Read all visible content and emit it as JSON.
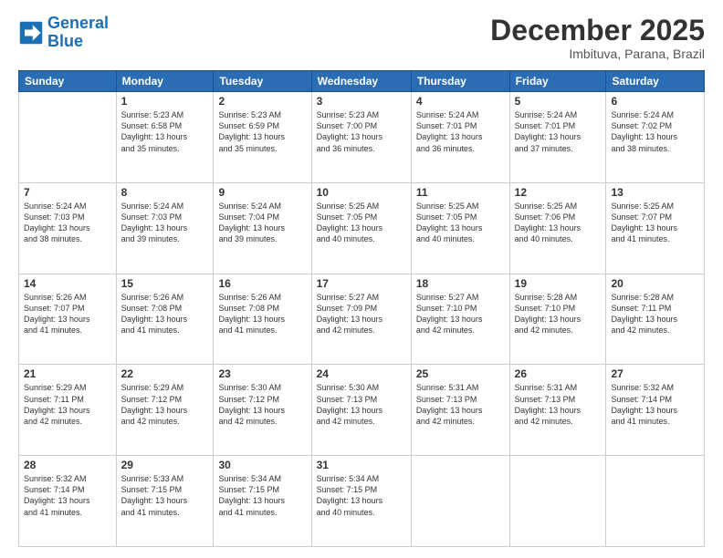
{
  "header": {
    "logo_line1": "General",
    "logo_line2": "Blue",
    "month": "December 2025",
    "location": "Imbituva, Parana, Brazil"
  },
  "days_of_week": [
    "Sunday",
    "Monday",
    "Tuesday",
    "Wednesday",
    "Thursday",
    "Friday",
    "Saturday"
  ],
  "weeks": [
    [
      {
        "day": "",
        "content": ""
      },
      {
        "day": "1",
        "content": "Sunrise: 5:23 AM\nSunset: 6:58 PM\nDaylight: 13 hours\nand 35 minutes."
      },
      {
        "day": "2",
        "content": "Sunrise: 5:23 AM\nSunset: 6:59 PM\nDaylight: 13 hours\nand 35 minutes."
      },
      {
        "day": "3",
        "content": "Sunrise: 5:23 AM\nSunset: 7:00 PM\nDaylight: 13 hours\nand 36 minutes."
      },
      {
        "day": "4",
        "content": "Sunrise: 5:24 AM\nSunset: 7:01 PM\nDaylight: 13 hours\nand 36 minutes."
      },
      {
        "day": "5",
        "content": "Sunrise: 5:24 AM\nSunset: 7:01 PM\nDaylight: 13 hours\nand 37 minutes."
      },
      {
        "day": "6",
        "content": "Sunrise: 5:24 AM\nSunset: 7:02 PM\nDaylight: 13 hours\nand 38 minutes."
      }
    ],
    [
      {
        "day": "7",
        "content": "Sunrise: 5:24 AM\nSunset: 7:03 PM\nDaylight: 13 hours\nand 38 minutes."
      },
      {
        "day": "8",
        "content": "Sunrise: 5:24 AM\nSunset: 7:03 PM\nDaylight: 13 hours\nand 39 minutes."
      },
      {
        "day": "9",
        "content": "Sunrise: 5:24 AM\nSunset: 7:04 PM\nDaylight: 13 hours\nand 39 minutes."
      },
      {
        "day": "10",
        "content": "Sunrise: 5:25 AM\nSunset: 7:05 PM\nDaylight: 13 hours\nand 40 minutes."
      },
      {
        "day": "11",
        "content": "Sunrise: 5:25 AM\nSunset: 7:05 PM\nDaylight: 13 hours\nand 40 minutes."
      },
      {
        "day": "12",
        "content": "Sunrise: 5:25 AM\nSunset: 7:06 PM\nDaylight: 13 hours\nand 40 minutes."
      },
      {
        "day": "13",
        "content": "Sunrise: 5:25 AM\nSunset: 7:07 PM\nDaylight: 13 hours\nand 41 minutes."
      }
    ],
    [
      {
        "day": "14",
        "content": "Sunrise: 5:26 AM\nSunset: 7:07 PM\nDaylight: 13 hours\nand 41 minutes."
      },
      {
        "day": "15",
        "content": "Sunrise: 5:26 AM\nSunset: 7:08 PM\nDaylight: 13 hours\nand 41 minutes."
      },
      {
        "day": "16",
        "content": "Sunrise: 5:26 AM\nSunset: 7:08 PM\nDaylight: 13 hours\nand 41 minutes."
      },
      {
        "day": "17",
        "content": "Sunrise: 5:27 AM\nSunset: 7:09 PM\nDaylight: 13 hours\nand 42 minutes."
      },
      {
        "day": "18",
        "content": "Sunrise: 5:27 AM\nSunset: 7:10 PM\nDaylight: 13 hours\nand 42 minutes."
      },
      {
        "day": "19",
        "content": "Sunrise: 5:28 AM\nSunset: 7:10 PM\nDaylight: 13 hours\nand 42 minutes."
      },
      {
        "day": "20",
        "content": "Sunrise: 5:28 AM\nSunset: 7:11 PM\nDaylight: 13 hours\nand 42 minutes."
      }
    ],
    [
      {
        "day": "21",
        "content": "Sunrise: 5:29 AM\nSunset: 7:11 PM\nDaylight: 13 hours\nand 42 minutes."
      },
      {
        "day": "22",
        "content": "Sunrise: 5:29 AM\nSunset: 7:12 PM\nDaylight: 13 hours\nand 42 minutes."
      },
      {
        "day": "23",
        "content": "Sunrise: 5:30 AM\nSunset: 7:12 PM\nDaylight: 13 hours\nand 42 minutes."
      },
      {
        "day": "24",
        "content": "Sunrise: 5:30 AM\nSunset: 7:13 PM\nDaylight: 13 hours\nand 42 minutes."
      },
      {
        "day": "25",
        "content": "Sunrise: 5:31 AM\nSunset: 7:13 PM\nDaylight: 13 hours\nand 42 minutes."
      },
      {
        "day": "26",
        "content": "Sunrise: 5:31 AM\nSunset: 7:13 PM\nDaylight: 13 hours\nand 42 minutes."
      },
      {
        "day": "27",
        "content": "Sunrise: 5:32 AM\nSunset: 7:14 PM\nDaylight: 13 hours\nand 41 minutes."
      }
    ],
    [
      {
        "day": "28",
        "content": "Sunrise: 5:32 AM\nSunset: 7:14 PM\nDaylight: 13 hours\nand 41 minutes."
      },
      {
        "day": "29",
        "content": "Sunrise: 5:33 AM\nSunset: 7:15 PM\nDaylight: 13 hours\nand 41 minutes."
      },
      {
        "day": "30",
        "content": "Sunrise: 5:34 AM\nSunset: 7:15 PM\nDaylight: 13 hours\nand 41 minutes."
      },
      {
        "day": "31",
        "content": "Sunrise: 5:34 AM\nSunset: 7:15 PM\nDaylight: 13 hours\nand 40 minutes."
      },
      {
        "day": "",
        "content": ""
      },
      {
        "day": "",
        "content": ""
      },
      {
        "day": "",
        "content": ""
      }
    ]
  ]
}
